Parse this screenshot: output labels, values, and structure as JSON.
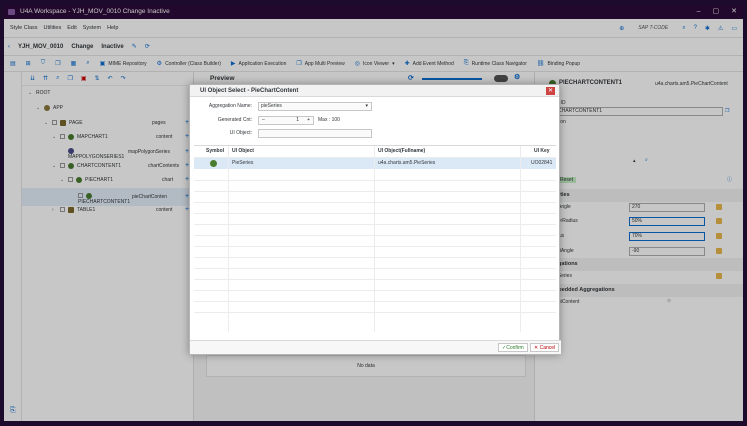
{
  "window": {
    "title": "U4A Workspace - YJH_MOV_0010 Change Inactive",
    "controls": [
      "minimize-icon",
      "maximize-icon",
      "close-icon"
    ]
  },
  "menu": {
    "items": [
      "Style Class",
      "Utilities",
      "Edit",
      "System",
      "Help"
    ],
    "sap_label": "SAP T-CODE"
  },
  "header": {
    "app_id": "YJH_MOV_0010",
    "mode": "Change",
    "status": "Inactive"
  },
  "toolbar": {
    "items": [
      "MIME Repository",
      "Controller (Class Builder)",
      "Application Execution",
      "App Multi Preview",
      "Icon Viewer",
      "Add Event Method",
      "Runtime Class Navigator",
      "Binding Popup"
    ]
  },
  "tree": {
    "nodes": [
      {
        "label": "ROOT",
        "agg": ""
      },
      {
        "label": "APP",
        "agg": ""
      },
      {
        "label": "PAGE",
        "agg": "pages"
      },
      {
        "label": "MAPCHART1",
        "agg": "content"
      },
      {
        "label": "MAPPOLYGONSERIES1",
        "agg": "mapPolygonSeries"
      },
      {
        "label": "CHARTCONTENT1",
        "agg": "chartContents"
      },
      {
        "label": "PIECHART1",
        "agg": "chart"
      },
      {
        "label": "PIECHARTCONTENT1",
        "agg": "pieChartConten"
      },
      {
        "label": "TABLE1",
        "agg": "content"
      }
    ]
  },
  "preview": {
    "title": "Preview",
    "no_data": "No data"
  },
  "right": {
    "title": "PIECHARTCONTENT1",
    "class_name": "u4a.charts.am5.PieChartContent",
    "id_label": "nt ID",
    "id_value": "CHARTCONTENT1",
    "section_label": "ption",
    "reset": "Reset",
    "props_header": "erties",
    "props": [
      {
        "name": "rtAngle",
        "value": "270"
      },
      {
        "name": "nerRadius",
        "value": "50%"
      },
      {
        "name": "dius",
        "value": "70%"
      },
      {
        "name": "artAngle",
        "value": "-90"
      }
    ],
    "agg_header": "egations",
    "agg_item": "eSeries",
    "emb_header": "nbedded Aggregations",
    "emb_item": "entContent"
  },
  "dialog": {
    "title": "UI Object Select - PieChartContent",
    "agg_label": "Aggregation Name:",
    "agg_value": "pieSeries",
    "gen_label": "Generated Cnt:",
    "gen_value": "1",
    "max_label": "Max : 100",
    "uiobj_label": "UI Object:",
    "uiobj_value": "",
    "columns": [
      "Symbol",
      "UI Object",
      "UI Object(Fullname)",
      "UI Key"
    ],
    "rows": [
      {
        "symbol": "check-icon",
        "object": "PieSeries",
        "fullname": "u4a.charts.am5.PieSeries",
        "key": "UO02841"
      }
    ],
    "confirm": "Confirm",
    "cancel": "Cancel"
  },
  "colors": {
    "title_bar": "#2d0b3a",
    "accent": "#0a6ed1",
    "selected_row": "#dbe9f7"
  }
}
